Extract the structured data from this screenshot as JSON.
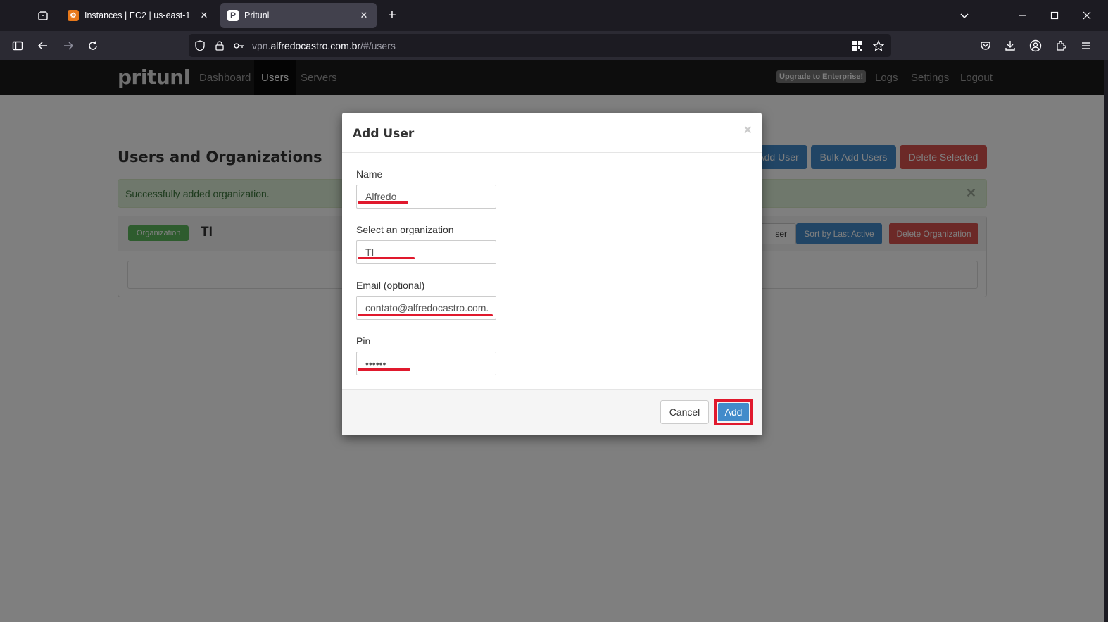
{
  "browser": {
    "tabs": [
      {
        "title": "Instances | EC2 | us-east-1",
        "favicon": "aws-icon",
        "active": false
      },
      {
        "title": "Pritunl",
        "favicon": "pritunl-icon",
        "active": true
      }
    ],
    "url_prefix": "vpn.",
    "url_domain": "alfredocastro.com.br",
    "url_path": "/#/users"
  },
  "app": {
    "logo": "pritunl",
    "nav": [
      "Dashboard",
      "Users",
      "Servers"
    ],
    "upgrade": "Upgrade to Enterprise!",
    "right_nav": [
      "Logs",
      "Settings",
      "Logout"
    ]
  },
  "page": {
    "title": "Users and Organizations",
    "buttons": {
      "add_user": "Add User",
      "bulk_add": "Bulk Add Users",
      "delete_selected": "Delete Selected"
    },
    "alert": "Successfully added organization.",
    "org": {
      "label": "Organization",
      "name": "TI",
      "add_user_partial": "ser",
      "sort": "Sort by Last Active",
      "delete": "Delete Organization"
    }
  },
  "modal": {
    "title": "Add User",
    "close": "×",
    "fields": {
      "name_label": "Name",
      "name_value": "Alfredo",
      "org_label": "Select an organization",
      "org_value": "TI",
      "email_label": "Email (optional)",
      "email_value": "contato@alfredocastro.com.",
      "pin_label": "Pin",
      "pin_value": "••••••"
    },
    "cancel": "Cancel",
    "add": "Add"
  },
  "colors": {
    "primary": "#428bca",
    "danger": "#d9534f",
    "success": "#5cb85c",
    "highlight": "#e0192d"
  }
}
